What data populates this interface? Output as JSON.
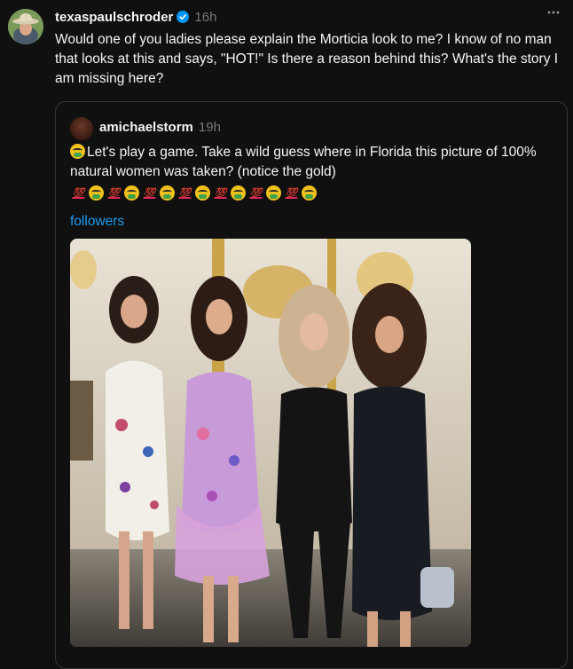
{
  "post": {
    "username": "texaspaulschroder",
    "time": "16h",
    "text": "Would one of you ladies please explain the Morticia look to me? I know of no man that looks at this and says, \"HOT!\" Is there a reason behind this? What's the story I am missing here?",
    "avatar_icon": "cowboy-hat-avatar",
    "verified_icon": "verified-badge-icon",
    "more_icon": "more-horizontal-icon"
  },
  "quoted": {
    "username": "amichaelstorm",
    "time": "19h",
    "text": "Let's play a game. Take a wild guess where in Florida this picture of 100% natural women was taken? (notice the gold)",
    "lead_emoji": "nauseated-face-icon",
    "emoji_row": [
      "100",
      "nauseated",
      "100",
      "nauseated",
      "100",
      "nauseated",
      "100",
      "nauseated",
      "100",
      "nauseated",
      "100",
      "nauseated",
      "100",
      "nauseated"
    ],
    "hundred_label": "💯",
    "link": "followers",
    "image": "photo-of-four-women-in-gold-ornate-room"
  },
  "colors": {
    "background": "#101010",
    "text": "#f3f5f7",
    "muted": "#777777",
    "link": "#1d9bf0",
    "border": "#333638",
    "verified": "#0095f6"
  }
}
